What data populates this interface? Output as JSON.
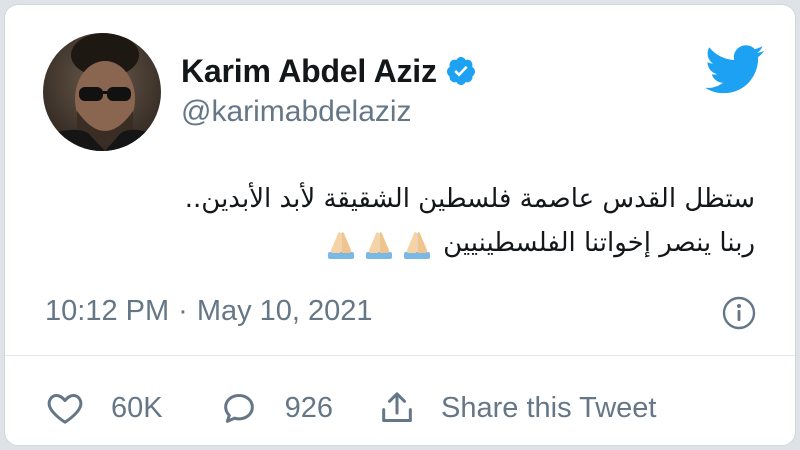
{
  "tweet": {
    "author": {
      "display_name": "Karim Abdel Aziz",
      "handle": "@karimabdelaziz",
      "verified": true
    },
    "text_lines": [
      "ستظل القدس عاصمة فلسطين الشقيقة لأبد الأبدين..",
      "ربنا ينصر إخواتنا الفلسطينيين"
    ],
    "emoji": [
      "folded-hands",
      "folded-hands",
      "folded-hands"
    ],
    "time": "10:12 PM",
    "separator": "·",
    "date": "May 10, 2021",
    "likes": "60K",
    "replies": "926",
    "share_label": "Share this Tweet"
  },
  "icons": {
    "brand": "twitter-bird-icon",
    "verified": "verified-badge-icon",
    "info": "info-icon",
    "like": "heart-icon",
    "reply": "speech-bubble-icon",
    "share": "share-upload-icon"
  },
  "colors": {
    "twitter_blue": "#1da1f2",
    "text": "#14171a",
    "muted": "#657786"
  }
}
